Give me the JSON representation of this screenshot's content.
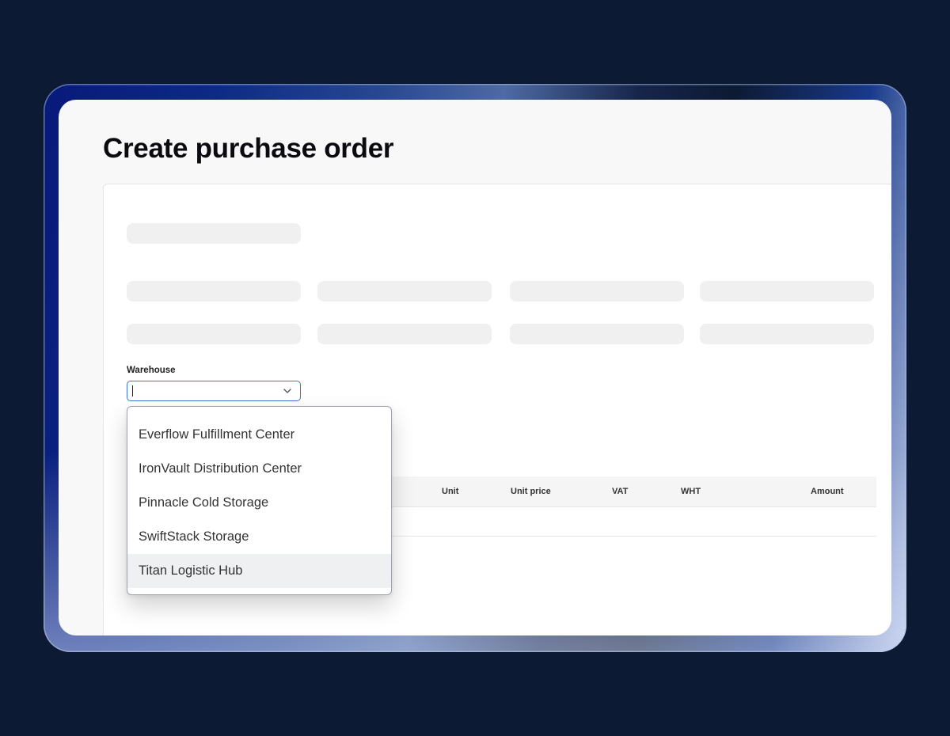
{
  "page": {
    "title": "Create purchase order"
  },
  "form": {
    "warehouse_label": "Warehouse",
    "warehouse_value": ""
  },
  "table": {
    "columns": [
      "Unit",
      "Unit price",
      "VAT",
      "WHT",
      "Amount"
    ]
  },
  "dropdown": {
    "options": [
      "Everflow Fulfillment Center",
      "IronVault Distribution Center",
      "Pinnacle Cold Storage",
      "SwiftStack Storage",
      "Titan Logistic Hub"
    ],
    "highlighted_option": "Titan Logistic Hub"
  },
  "colors": {
    "background": "#0c1a33",
    "focus_border": "#3f72d8",
    "highlight": "#eef0f1"
  },
  "icons": {
    "select": "chevron-down-icon"
  }
}
